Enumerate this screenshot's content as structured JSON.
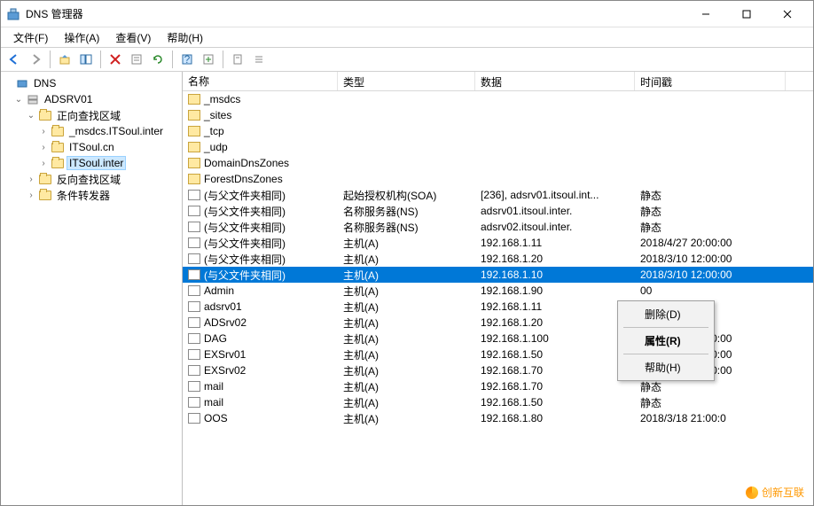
{
  "window": {
    "title": "DNS 管理器"
  },
  "menu": {
    "file": "文件(F)",
    "action": "操作(A)",
    "view": "查看(V)",
    "help": "帮助(H)"
  },
  "tree": {
    "root": "DNS",
    "server": "ADSRV01",
    "fwd": "正向查找区域",
    "z1": "_msdcs.ITSoul.inter",
    "z2": "ITSoul.cn",
    "z3": "ITSoul.inter",
    "rev": "反向查找区域",
    "cf": "条件转发器"
  },
  "columns": {
    "name": "名称",
    "type": "类型",
    "data": "数据",
    "ts": "时间戳"
  },
  "rows": [
    {
      "name": "_msdcs",
      "type": "",
      "data": "",
      "ts": "",
      "icon": "fold"
    },
    {
      "name": "_sites",
      "type": "",
      "data": "",
      "ts": "",
      "icon": "fold"
    },
    {
      "name": "_tcp",
      "type": "",
      "data": "",
      "ts": "",
      "icon": "fold"
    },
    {
      "name": "_udp",
      "type": "",
      "data": "",
      "ts": "",
      "icon": "fold"
    },
    {
      "name": "DomainDnsZones",
      "type": "",
      "data": "",
      "ts": "",
      "icon": "fold"
    },
    {
      "name": "ForestDnsZones",
      "type": "",
      "data": "",
      "ts": "",
      "icon": "fold"
    },
    {
      "name": "(与父文件夹相同)",
      "type": "起始授权机构(SOA)",
      "data": "[236], adsrv01.itsoul.int...",
      "ts": "静态",
      "icon": "rec"
    },
    {
      "name": "(与父文件夹相同)",
      "type": "名称服务器(NS)",
      "data": "adsrv01.itsoul.inter.",
      "ts": "静态",
      "icon": "rec"
    },
    {
      "name": "(与父文件夹相同)",
      "type": "名称服务器(NS)",
      "data": "adsrv02.itsoul.inter.",
      "ts": "静态",
      "icon": "rec"
    },
    {
      "name": "(与父文件夹相同)",
      "type": "主机(A)",
      "data": "192.168.1.11",
      "ts": "2018/4/27 20:00:00",
      "icon": "rec"
    },
    {
      "name": "(与父文件夹相同)",
      "type": "主机(A)",
      "data": "192.168.1.20",
      "ts": "2018/3/10 12:00:00",
      "icon": "rec"
    },
    {
      "name": "(与父文件夹相同)",
      "type": "主机(A)",
      "data": "192.168.1.10",
      "ts": "2018/3/10 12:00:00",
      "icon": "rec",
      "sel": true
    },
    {
      "name": "Admin",
      "type": "主机(A)",
      "data": "192.168.1.90",
      "ts": "00",
      "icon": "rec"
    },
    {
      "name": "adsrv01",
      "type": "主机(A)",
      "data": "192.168.1.11",
      "ts": "",
      "icon": "rec"
    },
    {
      "name": "ADSrv02",
      "type": "主机(A)",
      "data": "192.168.1.20",
      "ts": "",
      "icon": "rec"
    },
    {
      "name": "DAG",
      "type": "主机(A)",
      "data": "192.168.1.100",
      "ts": "2018/4/27 20:00:00",
      "icon": "rec"
    },
    {
      "name": "EXSrv01",
      "type": "主机(A)",
      "data": "192.168.1.50",
      "ts": "2018/4/27 20:00:00",
      "icon": "rec"
    },
    {
      "name": "EXSrv02",
      "type": "主机(A)",
      "data": "192.168.1.70",
      "ts": "2018/4/27 20:00:00",
      "icon": "rec"
    },
    {
      "name": "mail",
      "type": "主机(A)",
      "data": "192.168.1.70",
      "ts": "静态",
      "icon": "rec"
    },
    {
      "name": "mail",
      "type": "主机(A)",
      "data": "192.168.1.50",
      "ts": "静态",
      "icon": "rec"
    },
    {
      "name": "OOS",
      "type": "主机(A)",
      "data": "192.168.1.80",
      "ts": "2018/3/18 21:00:0",
      "icon": "rec"
    }
  ],
  "context": {
    "delete": "删除(D)",
    "props": "属性(R)",
    "help": "帮助(H)"
  },
  "watermark": "创新互联"
}
